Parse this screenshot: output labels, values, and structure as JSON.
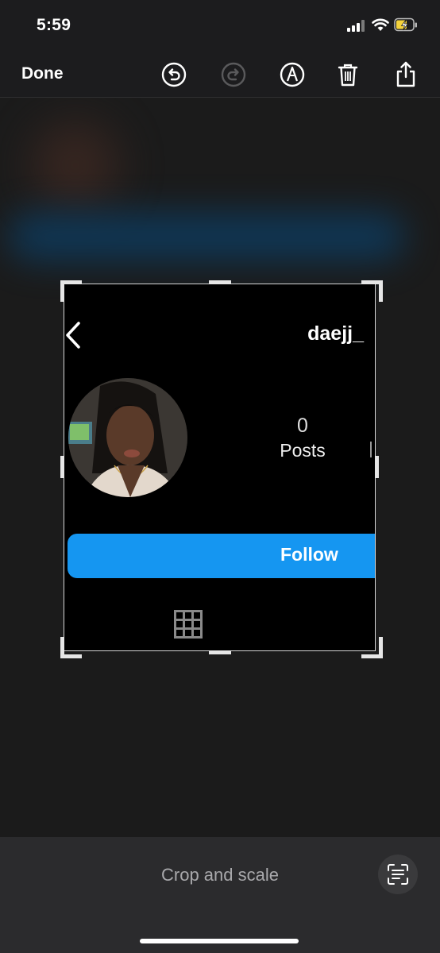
{
  "status": {
    "time": "5:59"
  },
  "toolbar": {
    "done_label": "Done",
    "icons": [
      "undo-icon",
      "redo-icon",
      "markup-icon",
      "trash-icon",
      "share-icon"
    ]
  },
  "profile": {
    "username": "daejj_",
    "posts_count": "0",
    "posts_label": "Posts",
    "follow_label": "Follow"
  },
  "bottom": {
    "title": "Crop and scale"
  },
  "colors": {
    "accent": "#1596f1",
    "background": "#1c1c1e",
    "panel": "#2b2b2d"
  }
}
